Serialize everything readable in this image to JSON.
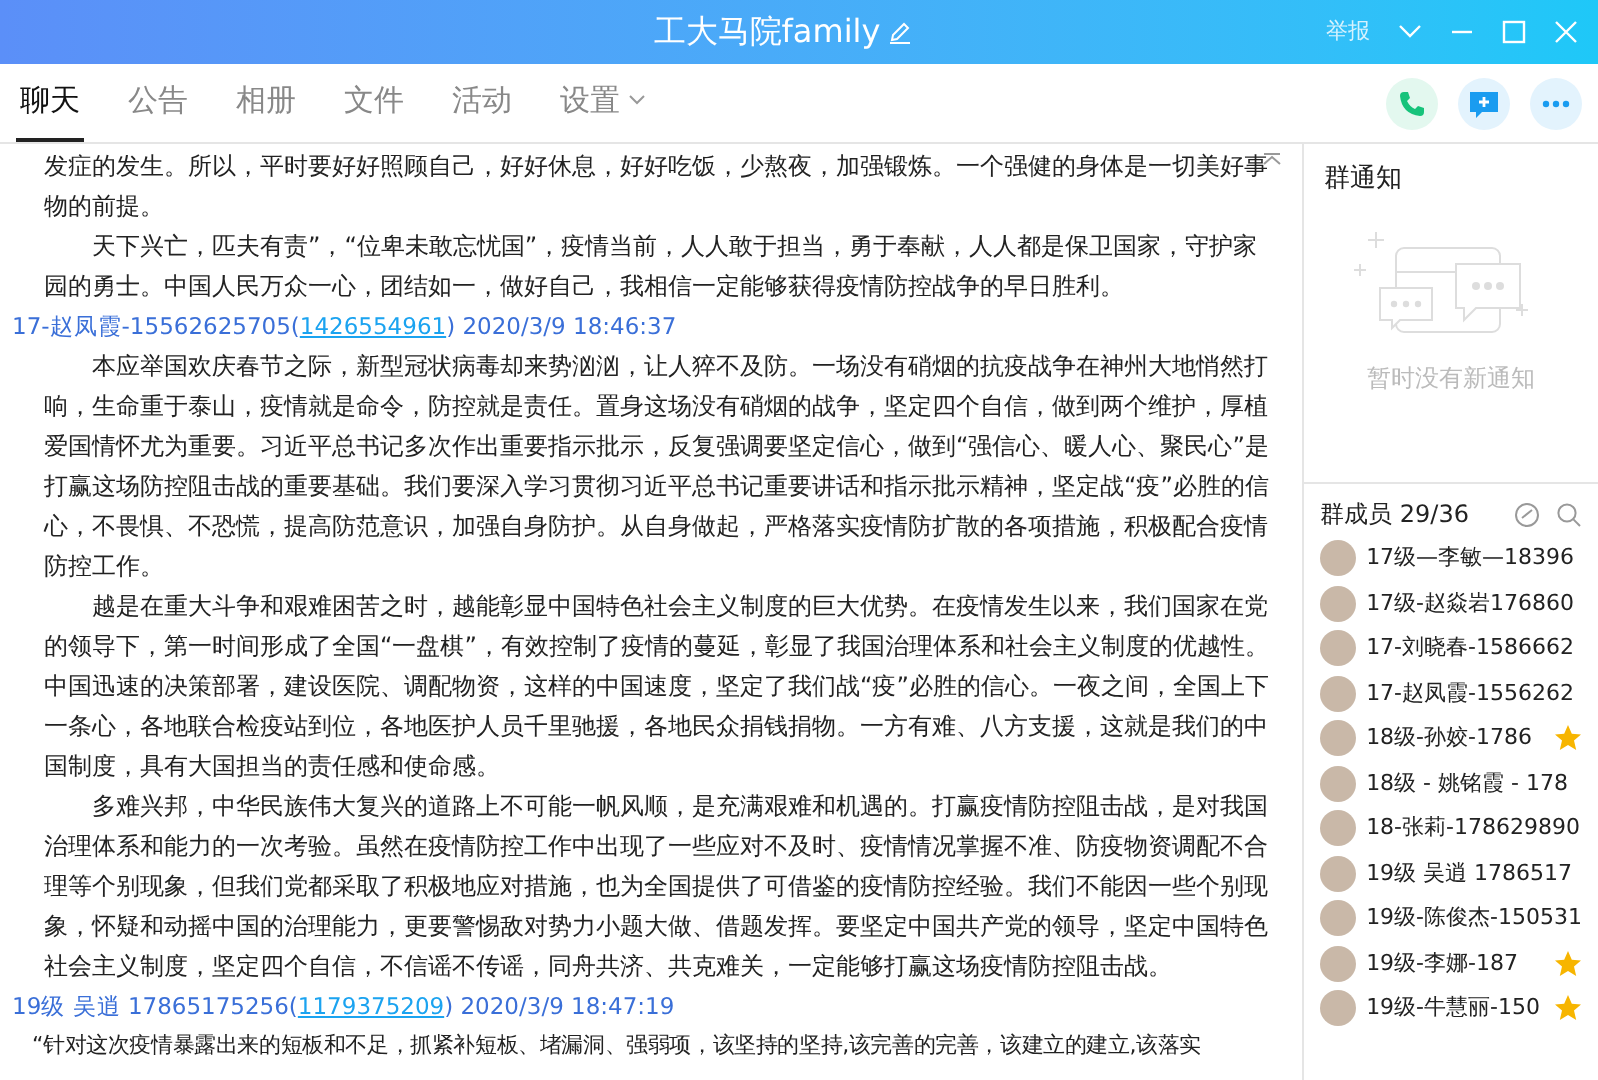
{
  "window": {
    "title": "工大马院family",
    "report": "举报"
  },
  "tabs": [
    {
      "label": "聊天",
      "selected": true,
      "dropdown": false
    },
    {
      "label": "公告",
      "selected": false,
      "dropdown": false
    },
    {
      "label": "相册",
      "selected": false,
      "dropdown": false
    },
    {
      "label": "文件",
      "selected": false,
      "dropdown": false
    },
    {
      "label": "活动",
      "selected": false,
      "dropdown": false
    },
    {
      "label": "设置",
      "selected": false,
      "dropdown": true
    }
  ],
  "messages": [
    {
      "paragraphs": [
        {
          "text": "发症的发生。所以，平时要好好照顾自己，好好休息，好好吃饭，少熬夜，加强锻炼。一个强健的身体是一切美好事物的前提。",
          "indent": false
        },
        {
          "text": "天下兴亡，匹夫有责”，“位卑未敢忘忧国”，疫情当前，人人敢于担当，勇于奉献，人人都是保卫国家，守护家园的勇士。中国人民万众一心，团结如一，做好自己，我相信一定能够获得疫情防控战争的早日胜利。",
          "indent": true
        }
      ]
    },
    {
      "header": {
        "name": "17-赵凤霞-15562625705(",
        "qq": "1426554961",
        "rest": ") 2020/3/9 18:46:37"
      },
      "paragraphs": [
        {
          "text": "本应举国欢庆春节之际，新型冠状病毒却来势汹汹，让人猝不及防。一场没有硝烟的抗疫战争在神州大地悄然打响，生命重于泰山，疫情就是命令，防控就是责任。置身这场没有硝烟的战争，坚定四个自信，做到两个维护，厚植爱国情怀尤为重要。习近平总书记多次作出重要指示批示，反复强调要坚定信心，做到“强信心、暖人心、聚民心”是打赢这场防控阻击战的重要基础。我们要深入学习贯彻习近平总书记重要讲话和指示批示精神，坚定战“疫”必胜的信心，不畏惧、不恐慌，提高防范意识，加强自身防护。从自身做起，严格落实疫情防扩散的各项措施，积极配合疫情防控工作。",
          "indent": true
        },
        {
          "text": "越是在重大斗争和艰难困苦之时，越能彰显中国特色社会主义制度的巨大优势。在疫情发生以来，我们国家在党的领导下，第一时间形成了全国“一盘棋”，有效控制了疫情的蔓延，彰显了我国治理体系和社会主义制度的优越性。中国迅速的决策部署，建设医院、调配物资，这样的中国速度，坚定了我们战“疫”必胜的信心。一夜之间，全国上下一条心，各地联合检疫站到位，各地医护人员千里驰援，各地民众捐钱捐物。一方有难、八方支援，这就是我们的中国制度，具有大国担当的责任感和使命感。",
          "indent": true
        },
        {
          "text": "多难兴邦，中华民族伟大复兴的道路上不可能一帆风顺，是充满艰难和机遇的。打赢疫情防控阻击战，是对我国治理体系和能力的一次考验。虽然在疫情防控工作中出现了一些应对不及时、疫情情况掌握不准、防疫物资调配不合理等个别现象，但我们党都采取了积极地应对措施，也为全国提供了可借鉴的疫情防控经验。我们不能因一些个别现象，怀疑和动摇中国的治理能力，更要警惕敌对势力小题大做、借题发挥。要坚定中国共产党的领导，坚定中国特色社会主义制度，坚定四个自信，不信谣不传谣，同舟共济、共克难关，一定能够打赢这场疫情防控阻击战。",
          "indent": true
        }
      ]
    },
    {
      "header": {
        "name": "19级 吴逍 17865175256(",
        "qq": "1179375209",
        "rest": ") 2020/3/9 18:47:19"
      },
      "paragraphs": [
        {
          "text": "“针对这次疫情暴露出来的短板和不足，抓紧补短板、堵漏洞、强弱项，该坚持的坚持,该完善的完善，该建立的建立,该落实",
          "indent": false
        }
      ]
    }
  ],
  "notice": {
    "title": "群通知",
    "empty": "暂时没有新通知"
  },
  "members": {
    "title": "群成员 29/36",
    "items": [
      {
        "name": "17级—李敏—18396",
        "admin": false
      },
      {
        "name": "17级-赵焱岩176860",
        "admin": false
      },
      {
        "name": "17-刘晓春-1586662",
        "admin": false
      },
      {
        "name": "17-赵凤霞-1556262",
        "admin": false
      },
      {
        "name": "18级-孙姣-1786",
        "admin": true
      },
      {
        "name": "18级 - 姚铭霞 - 178",
        "admin": false
      },
      {
        "name": "18-张莉-178629890",
        "admin": false
      },
      {
        "name": "19级 吴逍 1786517",
        "admin": false
      },
      {
        "name": "19级-陈俊杰-150531",
        "admin": false
      },
      {
        "name": "19级-李娜-187",
        "admin": true
      },
      {
        "name": "19级-牛慧丽-150",
        "admin": true
      }
    ]
  }
}
